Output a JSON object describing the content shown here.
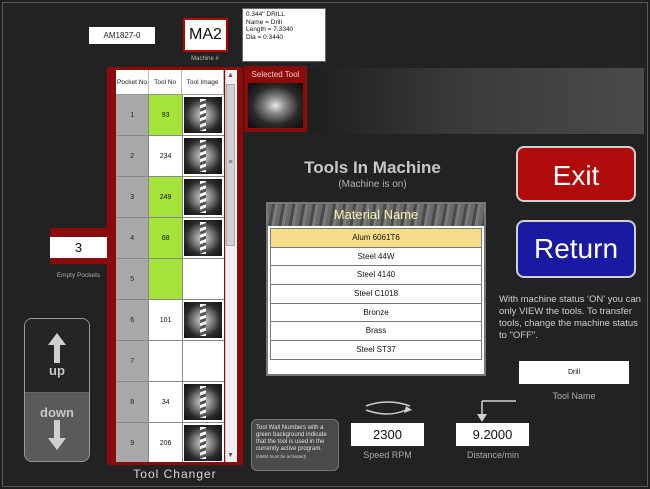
{
  "header": {
    "part_number": "AM1827-0",
    "machine_number": "MA2",
    "machine_label": "Machine #",
    "tool_info": [
      "0.344\" DRILL",
      "Name = Drill",
      "Length = 7.3340",
      "Dia = 0.3440"
    ]
  },
  "tool_changer": {
    "title": "Tool Changer",
    "columns": {
      "pocket": "Pocket No",
      "tool": "Tool No",
      "image": "Tool Image"
    },
    "rows": [
      {
        "pocket": "1",
        "tool": "93",
        "active": true,
        "has_image": true
      },
      {
        "pocket": "2",
        "tool": "234",
        "active": false,
        "has_image": true
      },
      {
        "pocket": "3",
        "tool": "249",
        "active": true,
        "has_image": true
      },
      {
        "pocket": "4",
        "tool": "68",
        "active": true,
        "has_image": true
      },
      {
        "pocket": "5",
        "tool": "",
        "active": true,
        "has_image": false
      },
      {
        "pocket": "6",
        "tool": "101",
        "active": false,
        "has_image": true
      },
      {
        "pocket": "7",
        "tool": "",
        "active": false,
        "has_image": false
      },
      {
        "pocket": "8",
        "tool": "34",
        "active": false,
        "has_image": true
      },
      {
        "pocket": "9",
        "tool": "206",
        "active": false,
        "has_image": true
      }
    ],
    "scroll_up": "▲",
    "scroll_down": "▼",
    "scroll_mid": "≡"
  },
  "selected_tool": {
    "label": "Selected Tool"
  },
  "empty_pockets": {
    "value": "3",
    "label": "Empty Pockets"
  },
  "nav": {
    "up": "up",
    "down": "down"
  },
  "main": {
    "title": "Tools In Machine",
    "subtitle": "(Machine is on)",
    "material_header": "Material Name",
    "materials": [
      {
        "name": "Alum 6061T6",
        "selected": true
      },
      {
        "name": "Steel 44W",
        "selected": false
      },
      {
        "name": "Steel 4140",
        "selected": false
      },
      {
        "name": "Steel C1018",
        "selected": false
      },
      {
        "name": "Bronze",
        "selected": false
      },
      {
        "name": "Brass",
        "selected": false
      },
      {
        "name": "Steel ST37",
        "selected": false
      }
    ]
  },
  "actions": {
    "exit": "Exit",
    "return": "Return"
  },
  "notice": "With machine status 'ON' you can only VIEW the tools. To transfer tools, change the machine status to \"OFF\".",
  "tool_name": {
    "value": "Drill",
    "label": "Tool Name"
  },
  "tip": {
    "text": "Tool Wall Numbers with a green background indicate that the tool is used in the currently active program.",
    "small": "(NMM must be activated)"
  },
  "speed": {
    "value": "2300",
    "label": "Speed RPM"
  },
  "distance": {
    "value": "9.2000",
    "label": "Distance/min"
  },
  "colors": {
    "accent_red": "#8b0a0a",
    "active_green": "#a6e33a",
    "exit": "#b00b0b",
    "return": "#1a1aa0",
    "selected_row": "#f7dd8a"
  }
}
